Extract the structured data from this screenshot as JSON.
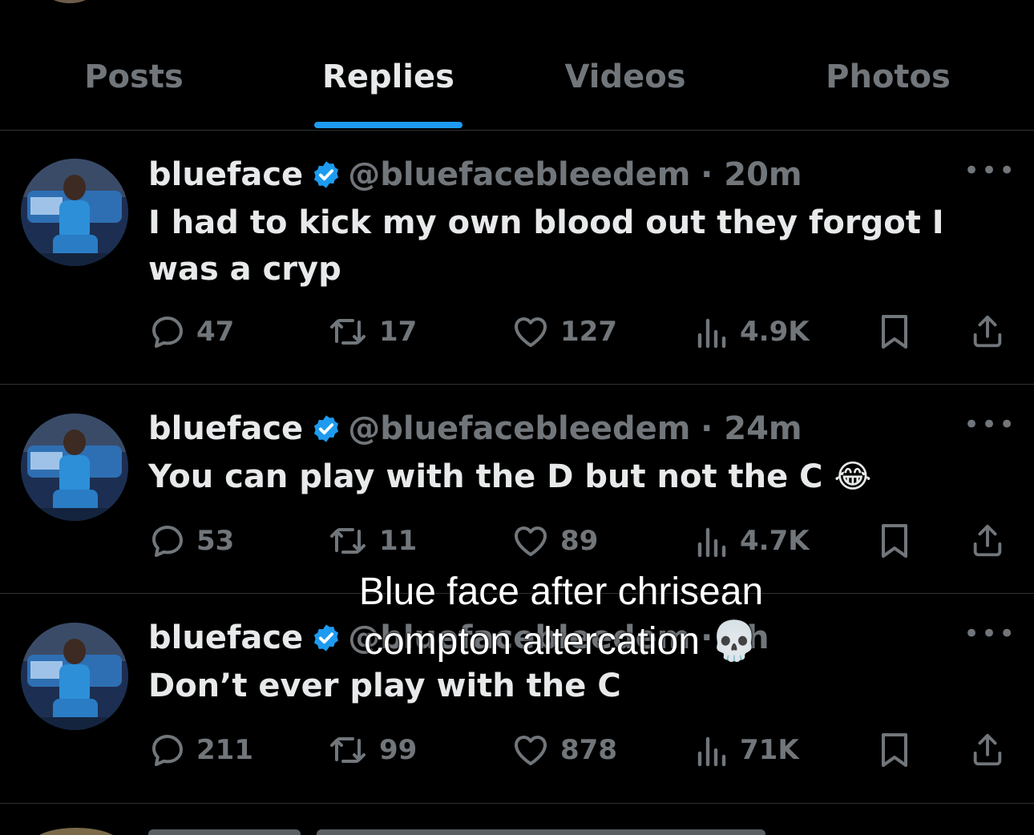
{
  "tabs": [
    {
      "label": "Posts",
      "active": false
    },
    {
      "label": "Replies",
      "active": true
    },
    {
      "label": "Videos",
      "active": false
    },
    {
      "label": "Photos",
      "active": false
    }
  ],
  "accent_color": "#1d9bf0",
  "posts": [
    {
      "name": "blueface",
      "handle": "@bluefacebleedem",
      "time": "· 20m",
      "text": "I had to kick my own blood out they forgot I was a cryp",
      "replies": "47",
      "reposts": "17",
      "likes": "127",
      "views": "4.9K"
    },
    {
      "name": "blueface",
      "handle": "@bluefacebleedem",
      "time": "· 24m",
      "text": "You can play with the D but not the C 😂",
      "replies": "53",
      "reposts": "11",
      "likes": "89",
      "views": "4.7K"
    },
    {
      "name": "blueface",
      "handle": "@bluefacebleedem",
      "time": "· 1h",
      "text": "Don’t ever play with the C",
      "replies": "211",
      "reposts": "99",
      "likes": "878",
      "views": "71K"
    }
  ],
  "overlay_caption": {
    "line1": "Blue face after chrisean",
    "line2": "compton altercation 💀"
  }
}
